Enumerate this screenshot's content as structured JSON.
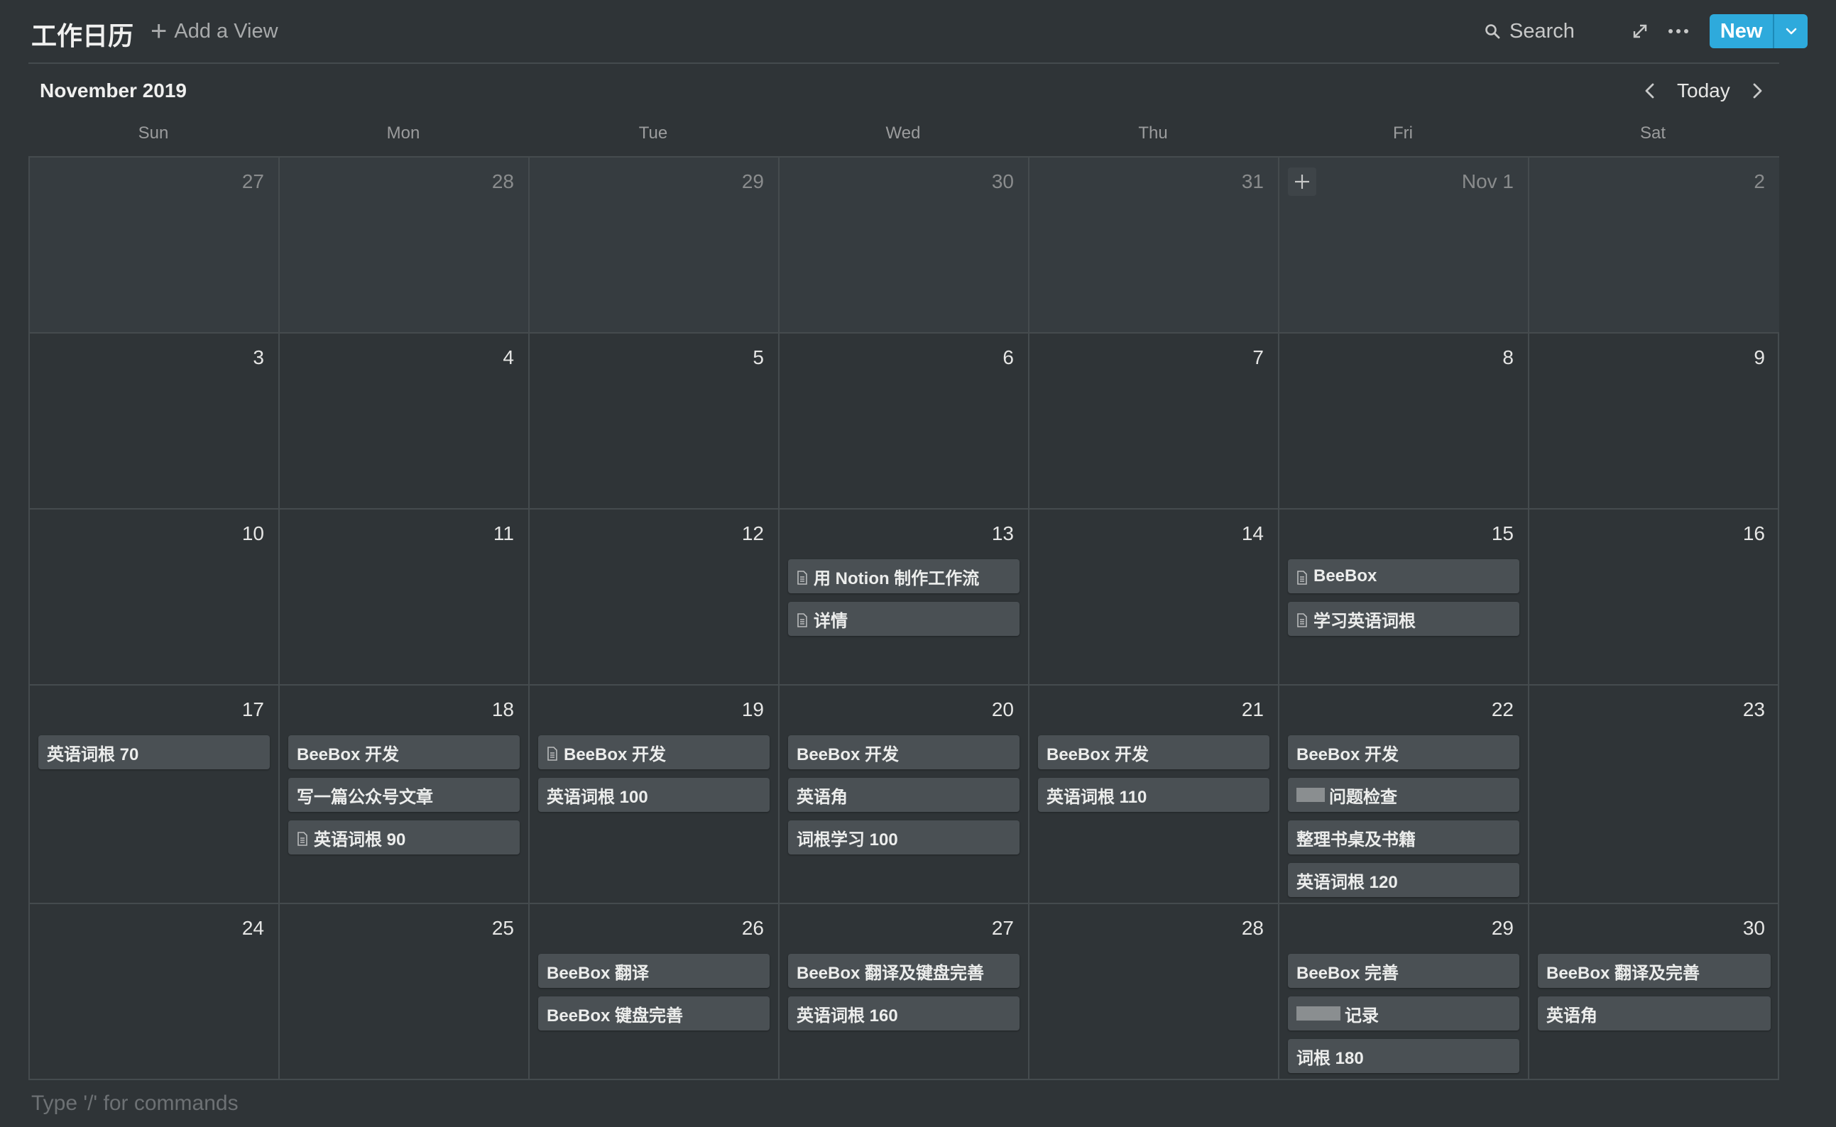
{
  "header": {
    "title": "工作日历",
    "add_view_label": "Add a View",
    "search_label": "Search",
    "new_label": "New"
  },
  "calendar": {
    "month_label": "November 2019",
    "today_label": "Today",
    "weekdays": [
      "Sun",
      "Mon",
      "Tue",
      "Wed",
      "Thu",
      "Fri",
      "Sat"
    ],
    "weeks": [
      [
        {
          "label": "27",
          "current_month": false,
          "events": []
        },
        {
          "label": "28",
          "current_month": false,
          "events": []
        },
        {
          "label": "29",
          "current_month": false,
          "events": []
        },
        {
          "label": "30",
          "current_month": false,
          "events": []
        },
        {
          "label": "31",
          "current_month": false,
          "events": []
        },
        {
          "label": "Nov 1",
          "current_month": false,
          "events": [],
          "show_add": true
        },
        {
          "label": "2",
          "current_month": false,
          "events": []
        }
      ],
      [
        {
          "label": "3",
          "current_month": true,
          "events": []
        },
        {
          "label": "4",
          "current_month": true,
          "events": []
        },
        {
          "label": "5",
          "current_month": true,
          "events": []
        },
        {
          "label": "6",
          "current_month": true,
          "events": []
        },
        {
          "label": "7",
          "current_month": true,
          "events": []
        },
        {
          "label": "8",
          "current_month": true,
          "events": []
        },
        {
          "label": "9",
          "current_month": true,
          "events": []
        }
      ],
      [
        {
          "label": "10",
          "current_month": true,
          "events": []
        },
        {
          "label": "11",
          "current_month": true,
          "events": []
        },
        {
          "label": "12",
          "current_month": true,
          "events": []
        },
        {
          "label": "13",
          "current_month": true,
          "events": [
            {
              "title": "用 Notion 制作工作流",
              "icon": "document-icon"
            },
            {
              "title": "详情",
              "icon": "document-icon"
            }
          ]
        },
        {
          "label": "14",
          "current_month": true,
          "events": []
        },
        {
          "label": "15",
          "current_month": true,
          "events": [
            {
              "title": "BeeBox",
              "icon": "document-icon"
            },
            {
              "title": "学习英语词根",
              "icon": "document-icon"
            }
          ]
        },
        {
          "label": "16",
          "current_month": true,
          "events": []
        }
      ],
      [
        {
          "label": "17",
          "current_month": true,
          "events": [
            {
              "title": "英语词根 70"
            }
          ]
        },
        {
          "label": "18",
          "current_month": true,
          "events": [
            {
              "title": "BeeBox 开发"
            },
            {
              "title": "写一篇公众号文章"
            },
            {
              "title": "英语词根 90",
              "icon": "document-icon"
            }
          ]
        },
        {
          "label": "19",
          "current_month": true,
          "events": [
            {
              "title": "BeeBox 开发",
              "icon": "document-icon"
            },
            {
              "title": "英语词根 100"
            }
          ]
        },
        {
          "label": "20",
          "current_month": true,
          "events": [
            {
              "title": "BeeBox 开发"
            },
            {
              "title": "英语角"
            },
            {
              "title": "词根学习 100"
            }
          ]
        },
        {
          "label": "21",
          "current_month": true,
          "events": [
            {
              "title": "BeeBox 开发"
            },
            {
              "title": "英语词根 110"
            }
          ]
        },
        {
          "label": "22",
          "current_month": true,
          "events": [
            {
              "title": "BeeBox 开发"
            },
            {
              "title": "问题检查",
              "redacted": true
            },
            {
              "title": "整理书桌及书籍"
            },
            {
              "title": "英语词根 120"
            }
          ]
        },
        {
          "label": "23",
          "current_month": true,
          "events": []
        }
      ],
      [
        {
          "label": "24",
          "current_month": true,
          "events": []
        },
        {
          "label": "25",
          "current_month": true,
          "events": []
        },
        {
          "label": "26",
          "current_month": true,
          "events": [
            {
              "title": "BeeBox 翻译"
            },
            {
              "title": "BeeBox 键盘完善"
            }
          ]
        },
        {
          "label": "27",
          "current_month": true,
          "events": [
            {
              "title": "BeeBox 翻译及键盘完善"
            },
            {
              "title": "英语词根 160"
            }
          ]
        },
        {
          "label": "28",
          "current_month": true,
          "events": []
        },
        {
          "label": "29",
          "current_month": true,
          "events": [
            {
              "title": "BeeBox 完善"
            },
            {
              "title": "记录",
              "redacted": true
            },
            {
              "title": "词根 180"
            }
          ]
        },
        {
          "label": "30",
          "current_month": true,
          "events": [
            {
              "title": "BeeBox 翻译及完善"
            },
            {
              "title": "英语角"
            }
          ]
        }
      ]
    ]
  },
  "footer": {
    "placeholder": "Type '/' for commands"
  },
  "colors": {
    "background": "#2f3437",
    "accent": "#2eaadc",
    "event_card": "#4a5054",
    "grid_line": "#454b4e"
  }
}
